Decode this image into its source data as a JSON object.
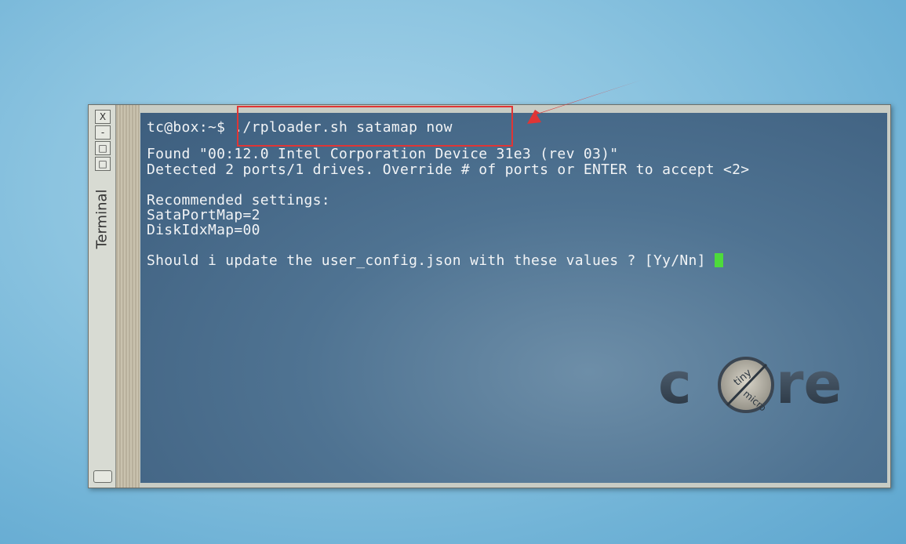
{
  "window": {
    "title": "Terminal",
    "buttons": {
      "close": "X",
      "minimize": "-",
      "maximize": "□",
      "restore": "□"
    }
  },
  "terminal": {
    "prompt": "tc@box:~$",
    "command": "./rploader.sh satamap now",
    "output": [
      "Found \"00:12.0 Intel Corporation Device 31e3 (rev 03)\"",
      "Detected 2 ports/1 drives. Override # of ports or ENTER to accept <2>",
      "Recommended settings:",
      "SataPortMap=2",
      "DiskIdxMap=00",
      "Should i update the user_config.json with these values ? [Yy/Nn]"
    ],
    "cursor_color": "#4ddb3b"
  },
  "watermark": {
    "logo_text": "core",
    "tagline_top": "tiny",
    "tagline_bottom": "micro"
  },
  "annotation": {
    "box_color": "#e03535",
    "arrow_color": "#e03535"
  }
}
